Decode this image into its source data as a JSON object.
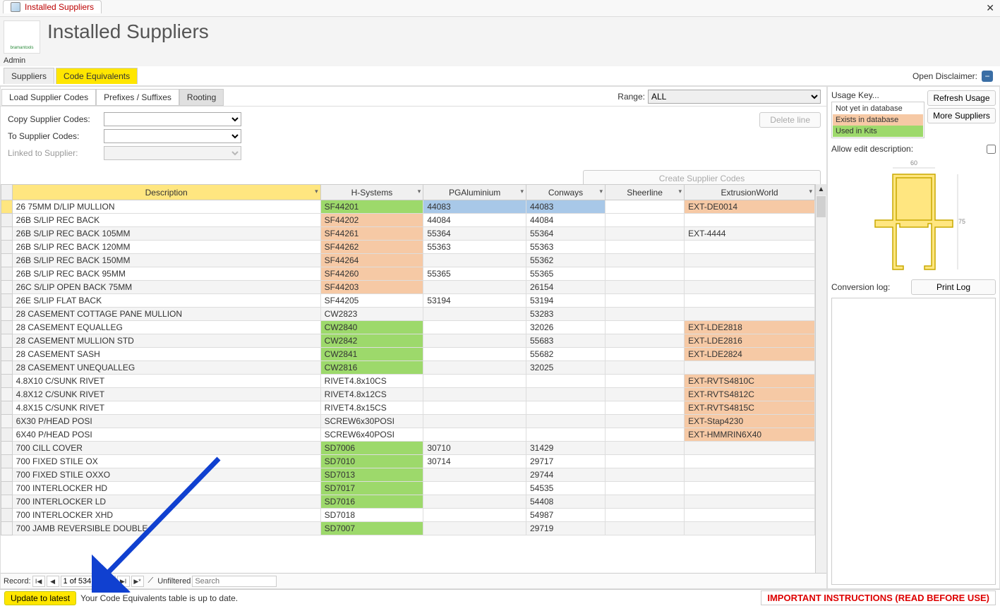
{
  "window": {
    "tab_title": "Installed Suppliers",
    "close": "✕"
  },
  "header": {
    "title": "Installed Suppliers",
    "logo": "bramantools",
    "admin": "Admin"
  },
  "top_tabs": {
    "t1": "Suppliers",
    "t2": "Code Equivalents",
    "disclaimer": "Open Disclaimer:",
    "disc_icon": "−"
  },
  "subtabs": {
    "t1": "Load Supplier Codes",
    "t2": "Prefixes / Suffixes",
    "t3": "Rooting",
    "range_label": "Range:",
    "range_val": "ALL"
  },
  "form": {
    "copy_label": "Copy Supplier Codes:",
    "to_label": "To Supplier Codes:",
    "linked_label": "Linked to Supplier:",
    "delete": "Delete line",
    "create": "Create Supplier Codes"
  },
  "cols": {
    "c1": "Description",
    "c2": "H-Systems",
    "c3": "PGAluminium",
    "c4": "Conways",
    "c5": "Sheerline",
    "c6": "ExtrusionWorld"
  },
  "rows": [
    {
      "d": "26 75MM D/LIP MULLION",
      "h": "SF44201",
      "p": "44083",
      "c": "44083",
      "s": "",
      "e": "EXT-DE0014",
      "hc": "c-green",
      "pc": "c-blue",
      "cc": "c-blue",
      "ec": "c-orange",
      "sel": true
    },
    {
      "d": "26B S/LIP REC BACK",
      "h": "SF44202",
      "p": "44084",
      "c": "44084",
      "s": "",
      "e": "",
      "hc": "c-orange"
    },
    {
      "d": "26B S/LIP REC BACK 105MM",
      "h": "SF44261",
      "p": "55364",
      "c": "55364",
      "s": "",
      "e": "EXT-4444",
      "hc": "c-orange",
      "alt": true
    },
    {
      "d": "26B S/LIP REC BACK 120MM",
      "h": "SF44262",
      "p": "55363",
      "c": "55363",
      "s": "",
      "e": "",
      "hc": "c-orange"
    },
    {
      "d": "26B S/LIP REC BACK 150MM",
      "h": "SF44264",
      "p": "",
      "c": "55362",
      "s": "",
      "e": "",
      "hc": "c-orange",
      "alt": true
    },
    {
      "d": "26B S/LIP REC BACK 95MM",
      "h": "SF44260",
      "p": "55365",
      "c": "55365",
      "s": "",
      "e": "",
      "hc": "c-orange"
    },
    {
      "d": "26C S/LIP OPEN BACK 75MM",
      "h": "SF44203",
      "p": "",
      "c": "26154",
      "s": "",
      "e": "",
      "hc": "c-orange",
      "alt": true
    },
    {
      "d": "26E S/LIP FLAT BACK",
      "h": "SF44205",
      "p": "53194",
      "c": "53194",
      "s": "",
      "e": ""
    },
    {
      "d": "28 CASEMENT COTTAGE PANE MULLION",
      "h": "CW2823",
      "p": "",
      "c": "53283",
      "s": "",
      "e": "",
      "alt": true
    },
    {
      "d": "28 CASEMENT EQUALLEG",
      "h": "CW2840",
      "p": "",
      "c": "32026",
      "s": "",
      "e": "EXT-LDE2818",
      "hc": "c-green",
      "ec": "c-orange"
    },
    {
      "d": "28 CASEMENT MULLION STD",
      "h": "CW2842",
      "p": "",
      "c": "55683",
      "s": "",
      "e": "EXT-LDE2816",
      "hc": "c-green",
      "ec": "c-orange",
      "alt": true
    },
    {
      "d": "28 CASEMENT SASH",
      "h": "CW2841",
      "p": "",
      "c": "55682",
      "s": "",
      "e": "EXT-LDE2824",
      "hc": "c-green",
      "ec": "c-orange"
    },
    {
      "d": "28 CASEMENT UNEQUALLEG",
      "h": "CW2816",
      "p": "",
      "c": "32025",
      "s": "",
      "e": "",
      "hc": "c-green",
      "alt": true
    },
    {
      "d": "4.8X10 C/SUNK RIVET",
      "h": "RIVET4.8x10CS",
      "p": "",
      "c": "",
      "s": "",
      "e": "EXT-RVTS4810C",
      "ec": "c-orange"
    },
    {
      "d": "4.8X12 C/SUNK RIVET",
      "h": "RIVET4.8x12CS",
      "p": "",
      "c": "",
      "s": "",
      "e": "EXT-RVTS4812C",
      "ec": "c-orange",
      "alt": true
    },
    {
      "d": "4.8X15 C/SUNK RIVET",
      "h": "RIVET4.8x15CS",
      "p": "",
      "c": "",
      "s": "",
      "e": "EXT-RVTS4815C",
      "ec": "c-orange"
    },
    {
      "d": "6X30 P/HEAD POSI",
      "h": "SCREW6x30POSI",
      "p": "",
      "c": "",
      "s": "",
      "e": "EXT-Stap4230",
      "ec": "c-orange",
      "alt": true
    },
    {
      "d": "6X40 P/HEAD POSI",
      "h": "SCREW6x40POSI",
      "p": "",
      "c": "",
      "s": "",
      "e": "EXT-HMMRIN6X40",
      "ec": "c-orange"
    },
    {
      "d": "700 CILL COVER",
      "h": "SD7006",
      "p": "30710",
      "c": "31429",
      "s": "",
      "e": "",
      "hc": "c-green",
      "alt": true
    },
    {
      "d": "700 FIXED STILE OX",
      "h": "SD7010",
      "p": "30714",
      "c": "29717",
      "s": "",
      "e": "",
      "hc": "c-green"
    },
    {
      "d": "700 FIXED STILE OXXO",
      "h": "SD7013",
      "p": "",
      "c": "29744",
      "s": "",
      "e": "",
      "hc": "c-green",
      "alt": true
    },
    {
      "d": "700 INTERLOCKER HD",
      "h": "SD7017",
      "p": "",
      "c": "54535",
      "s": "",
      "e": "",
      "hc": "c-green"
    },
    {
      "d": "700 INTERLOCKER LD",
      "h": "SD7016",
      "p": "",
      "c": "54408",
      "s": "",
      "e": "",
      "hc": "c-green",
      "alt": true
    },
    {
      "d": "700 INTERLOCKER XHD",
      "h": "SD7018",
      "p": "",
      "c": "54987",
      "s": "",
      "e": ""
    },
    {
      "d": "700 JAMB REVERSIBLE DOUBLE",
      "h": "SD7007",
      "p": "",
      "c": "29719",
      "s": "",
      "e": "",
      "hc": "c-green",
      "alt": true
    }
  ],
  "recnav": {
    "label": "Record:",
    "pos": "1 of 534",
    "unfiltered": "Unfiltered",
    "search": "Search"
  },
  "status": {
    "update": "Update to latest",
    "msg": "Your Code Equivalents table is up to date.",
    "important": "IMPORTANT INSTRUCTIONS  (READ BEFORE USE)"
  },
  "right": {
    "usage_key": "Usage Key...",
    "k1": "Not yet in database",
    "k2": "Exists in database",
    "k3": "Used in Kits",
    "refresh": "Refresh Usage",
    "more": "More Suppliers",
    "allow": "Allow edit description:",
    "convlog": "Conversion log:",
    "print": "Print Log",
    "dim60": "60",
    "dim75": "75"
  }
}
